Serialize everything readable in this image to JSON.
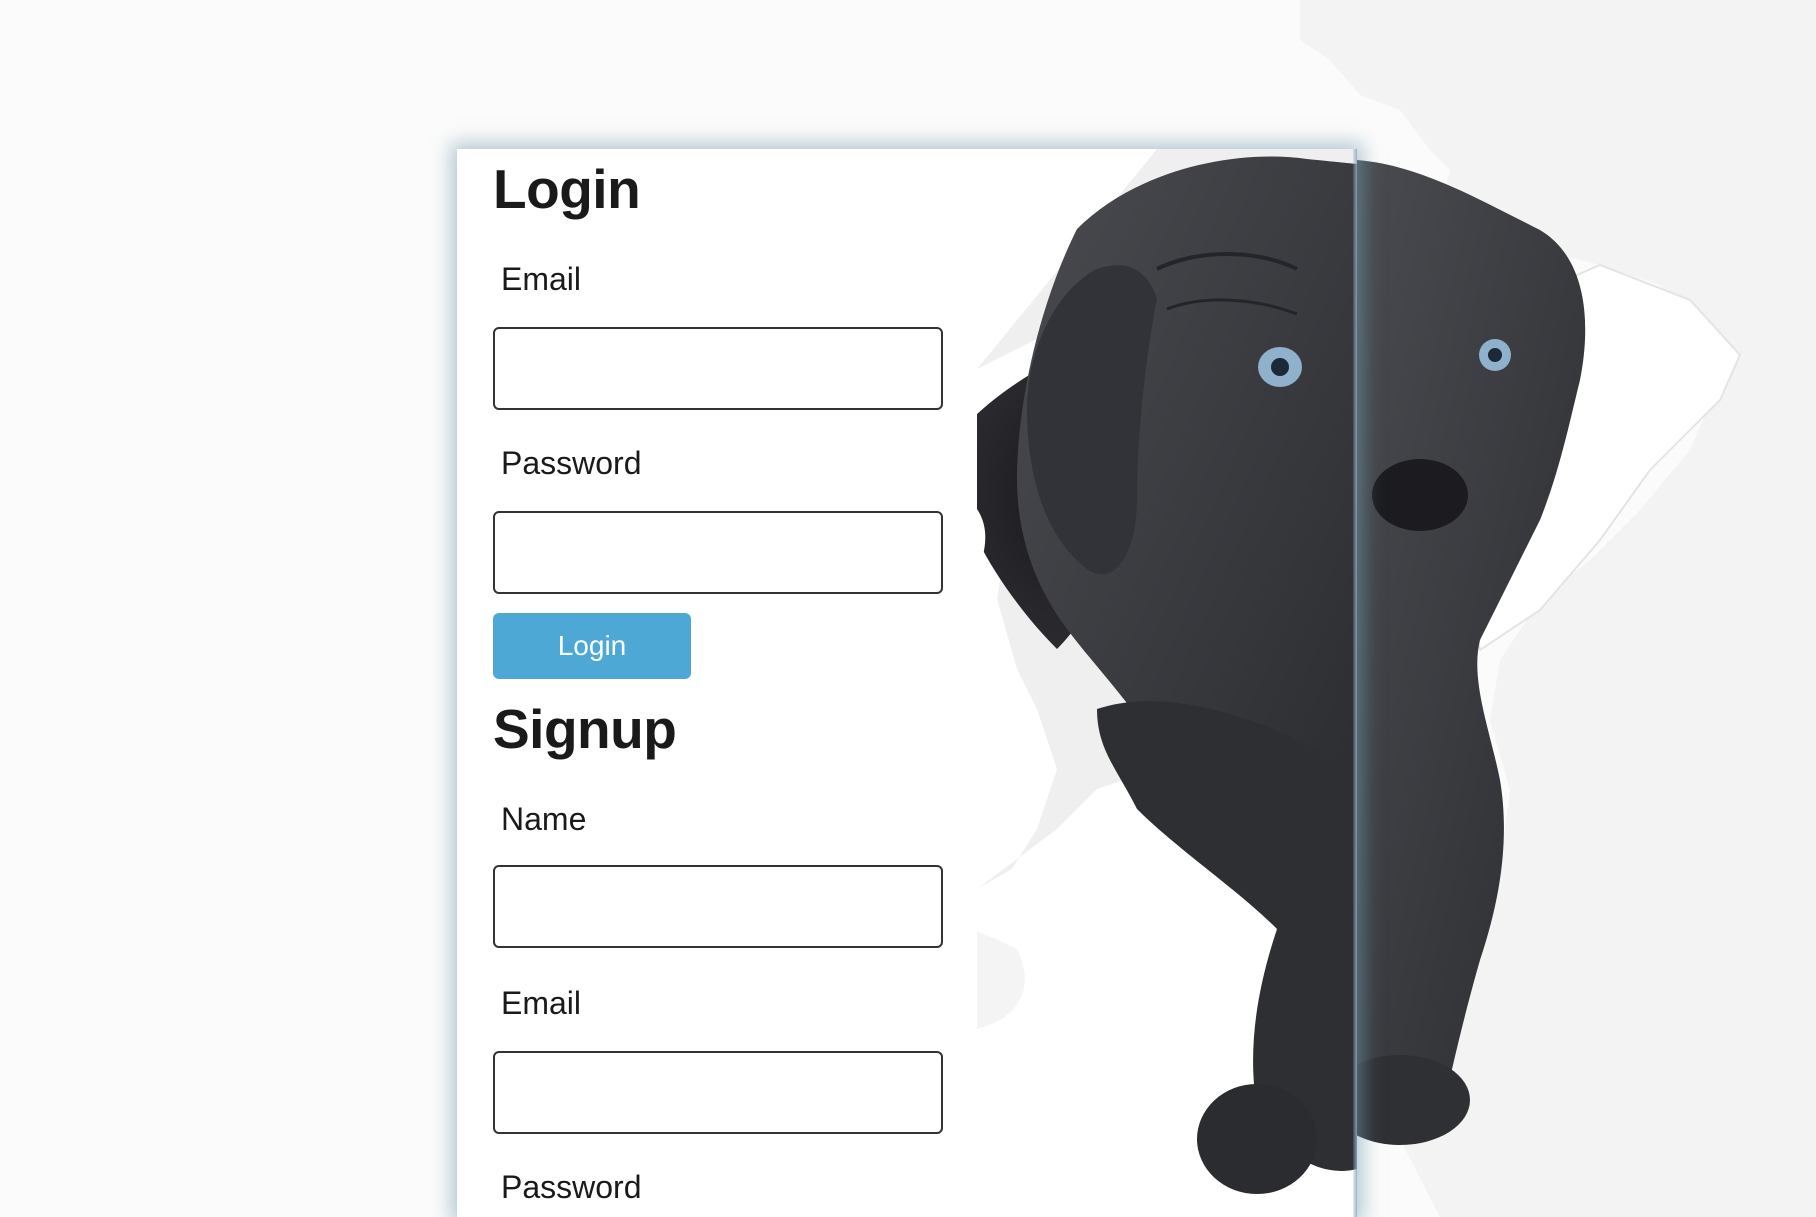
{
  "login": {
    "title": "Login",
    "email_label": "Email",
    "email_value": "",
    "password_label": "Password",
    "password_value": "",
    "submit_label": "Login"
  },
  "signup": {
    "title": "Signup",
    "name_label": "Name",
    "name_value": "",
    "email_label": "Email",
    "email_value": "",
    "password_label": "Password"
  },
  "colors": {
    "button_bg": "#4ea8d6",
    "button_text": "#ffffff",
    "text": "#1a1a1a",
    "card_glow": "#78a0b4"
  }
}
